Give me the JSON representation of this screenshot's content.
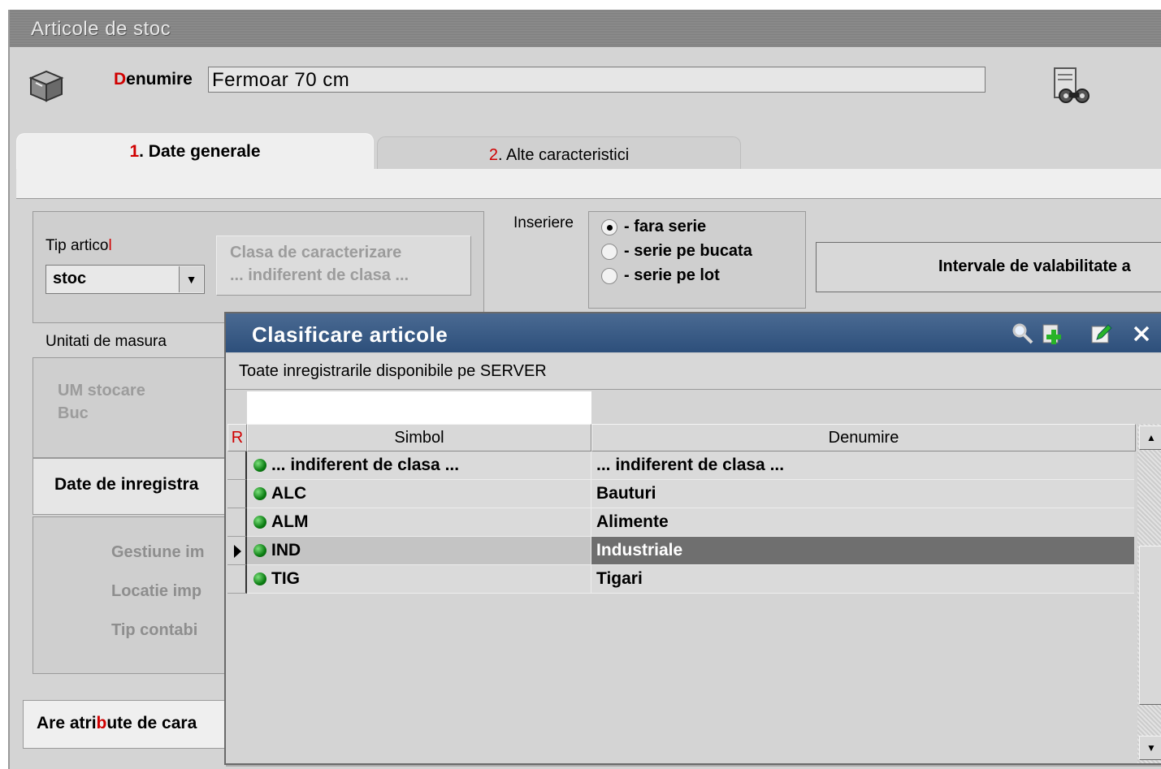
{
  "window": {
    "title": "Articole de stoc"
  },
  "header": {
    "denumire_hot": "D",
    "denumire_rest": "enumire",
    "denumire_value": "Fermoar 70 cm"
  },
  "tabs": [
    {
      "num": "1",
      "label": ". Date generale"
    },
    {
      "num": "2",
      "label": ". Alte caracteristici"
    }
  ],
  "general": {
    "tip_label_main": "Tip artico",
    "tip_label_hot": "l",
    "tip_value": "stoc",
    "clasa_line1": "Clasa de caracterizare",
    "clasa_line2": "... indiferent de clasa ...",
    "inserire_label": "Inseriere",
    "serie_options": [
      "- fara serie",
      "- serie pe bucata",
      "- serie pe lot"
    ],
    "serie_selected": 0,
    "interval_label": "Intervale de valabilitate a",
    "um_label": "Unitati de masura",
    "um_stocare_label": "UM stocare",
    "um_stocare_value": "Buc",
    "date_inregistrare_label": "Date de inregistra",
    "gestiune_label": "Gestiune im",
    "locatie_label": "Locatie imp",
    "tip_contabil_label": "Tip contabi",
    "atribute_pre": "Are atri",
    "atribute_hot": "b",
    "atribute_post": "ute de cara"
  },
  "popup": {
    "title": "Clasificare articole",
    "subtitle": "Toate inregistrarile disponibile pe SERVER",
    "filter_value": "",
    "columns": {
      "r": "R",
      "simbol": "Simbol",
      "denumire": "Denumire"
    },
    "rows": [
      {
        "simbol": "... indiferent de clasa ...",
        "denumire": "... indiferent de clasa ..."
      },
      {
        "simbol": "ALC",
        "denumire": "Bauturi"
      },
      {
        "simbol": "ALM",
        "denumire": "Alimente"
      },
      {
        "simbol": "IND",
        "denumire": "Industriale"
      },
      {
        "simbol": "TIG",
        "denumire": "Tigari"
      }
    ],
    "selected_row": 3,
    "icons": [
      "search-icon",
      "add-icon",
      "edit-icon",
      "close-icon"
    ]
  },
  "colors": {
    "popup_title_bg": "#2d4f7b",
    "hotkey": "#d00000",
    "selected_row_bg": "#6f6f6f",
    "status_dot": "#0b7d12"
  }
}
